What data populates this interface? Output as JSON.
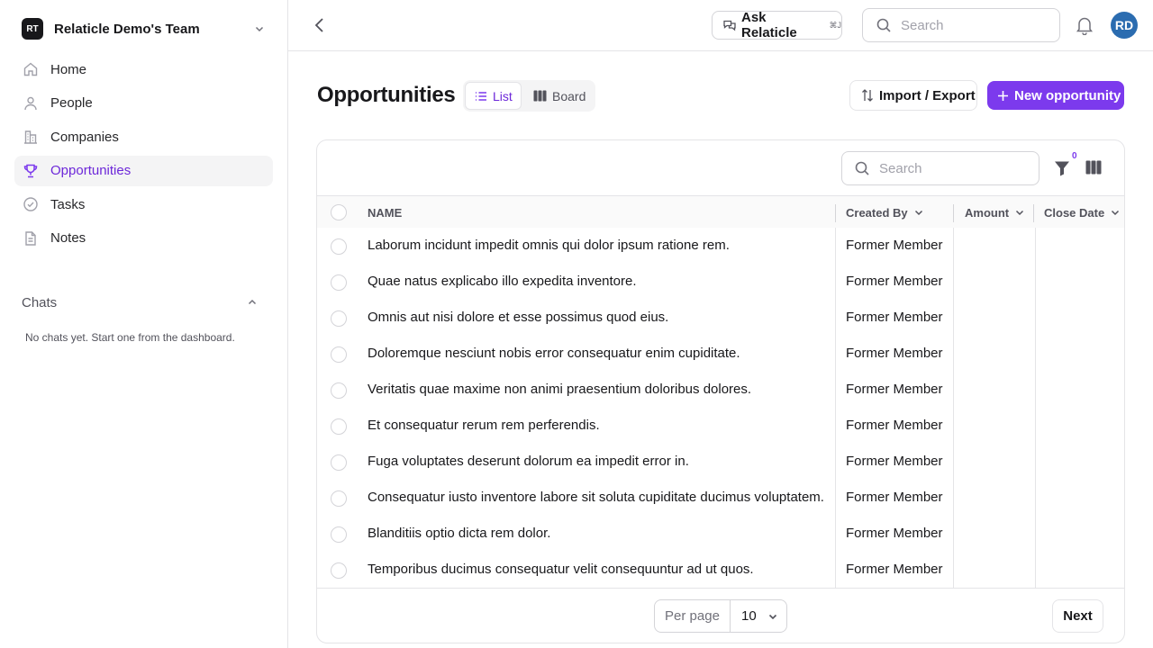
{
  "sidebar": {
    "team": {
      "initials": "RT",
      "name": "Relaticle Demo's Team"
    },
    "nav": [
      {
        "label": "Home",
        "icon": "home-icon"
      },
      {
        "label": "People",
        "icon": "person-icon"
      },
      {
        "label": "Companies",
        "icon": "building-icon"
      },
      {
        "label": "Opportunities",
        "icon": "trophy-icon",
        "active": true
      },
      {
        "label": "Tasks",
        "icon": "check-circle-icon"
      },
      {
        "label": "Notes",
        "icon": "document-icon"
      }
    ],
    "chats": {
      "title": "Chats",
      "empty": "No chats yet. Start one from the dashboard."
    }
  },
  "topbar": {
    "ask_label": "Ask Relaticle",
    "ask_shortcut": "⌘J",
    "search_placeholder": "Search",
    "avatar_initials": "RD"
  },
  "page": {
    "title": "Opportunities",
    "views": {
      "list": "List",
      "board": "Board"
    },
    "import_export": "Import / Export",
    "new_button": "New opportunity"
  },
  "table": {
    "search_placeholder": "Search",
    "filter_count": "0",
    "columns": {
      "name": "NAME",
      "created_by": "Created By",
      "amount": "Amount",
      "close_date": "Close Date"
    },
    "rows": [
      {
        "name": "Laborum incidunt impedit omnis qui dolor ipsum ratione rem.",
        "created_by": "Former Member"
      },
      {
        "name": "Quae natus explicabo illo expedita inventore.",
        "created_by": "Former Member"
      },
      {
        "name": "Omnis aut nisi dolore et esse possimus quod eius.",
        "created_by": "Former Member"
      },
      {
        "name": "Doloremque nesciunt nobis error consequatur enim cupiditate.",
        "created_by": "Former Member"
      },
      {
        "name": "Veritatis quae maxime non animi praesentium doloribus dolores.",
        "created_by": "Former Member"
      },
      {
        "name": "Et consequatur rerum rem perferendis.",
        "created_by": "Former Member"
      },
      {
        "name": "Fuga voluptates deserunt dolorum ea impedit error in.",
        "created_by": "Former Member"
      },
      {
        "name": "Consequatur iusto inventore labore sit soluta cupiditate ducimus voluptatem.",
        "created_by": "Former Member"
      },
      {
        "name": "Blanditiis optio dicta rem dolor.",
        "created_by": "Former Member"
      },
      {
        "name": "Temporibus ducimus consequatur velit consequuntur ad ut quos.",
        "created_by": "Former Member"
      }
    ],
    "pagination": {
      "per_page_label": "Per page",
      "per_page_value": "10",
      "next_label": "Next"
    }
  },
  "colors": {
    "accent": "#7c3aed",
    "avatar": "#2b6cb0"
  }
}
